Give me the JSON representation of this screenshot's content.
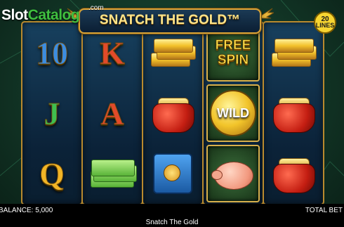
{
  "watermark": {
    "part1": "Slot",
    "part2": "Catalog",
    "suffix": ".com"
  },
  "title": "SNATCH THE GOLD™",
  "lines_badge": {
    "number": "20",
    "label": "LINES"
  },
  "reels": [
    {
      "symbols": [
        {
          "type": "letter",
          "text": "10",
          "color": "blue"
        },
        {
          "type": "letter",
          "text": "J",
          "color": "green"
        },
        {
          "type": "letter",
          "text": "Q",
          "color": "gold"
        }
      ]
    },
    {
      "symbols": [
        {
          "type": "letter",
          "text": "K",
          "color": "red"
        },
        {
          "type": "letter",
          "text": "A",
          "color": "red"
        },
        {
          "type": "cash",
          "icon": "cash-stack-icon"
        }
      ]
    },
    {
      "symbols": [
        {
          "type": "gold-bars",
          "icon": "gold-bars-icon"
        },
        {
          "type": "purse",
          "icon": "purse-icon"
        },
        {
          "type": "safe",
          "icon": "safe-icon"
        }
      ]
    },
    {
      "symbols": [
        {
          "type": "freespin",
          "text": "FREE SPIN"
        },
        {
          "type": "wild",
          "text": "WILD"
        },
        {
          "type": "pig",
          "icon": "piggy-bank-icon"
        }
      ]
    },
    {
      "symbols": [
        {
          "type": "gold-bars",
          "icon": "gold-bars-icon"
        },
        {
          "type": "purse",
          "icon": "purse-icon"
        },
        {
          "type": "purse",
          "icon": "purse-icon"
        }
      ]
    }
  ],
  "footer": {
    "balance": "BALANCE: 5,000",
    "total_bet": "TOTAL BET",
    "game_name": "Snatch The Gold"
  }
}
